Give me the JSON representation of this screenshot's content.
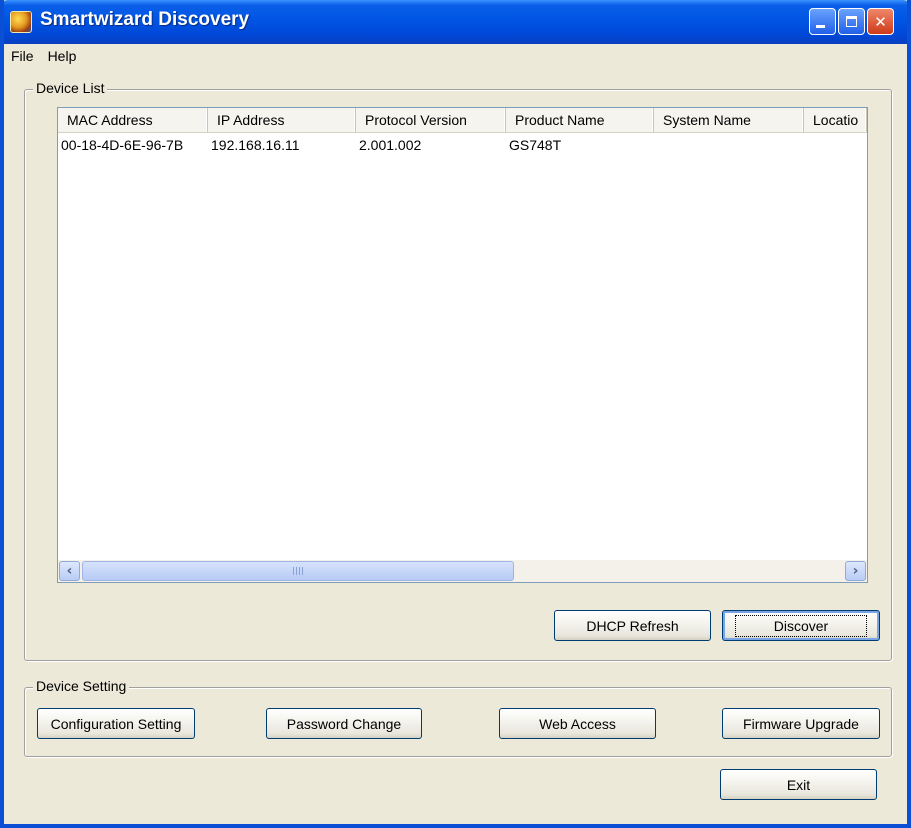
{
  "window": {
    "title": "Smartwizard Discovery"
  },
  "menu": {
    "file": "File",
    "help": "Help"
  },
  "device_list": {
    "group_label": "Device List",
    "columns": [
      "MAC Address",
      "IP Address",
      "Protocol Version",
      "Product Name",
      "System Name",
      "Locatio"
    ],
    "rows": [
      {
        "mac": "00-18-4D-6E-96-7B",
        "ip": "192.168.16.11",
        "protocol": "2.001.002",
        "product": "GS748T",
        "system_name": "",
        "location": ""
      }
    ],
    "buttons": {
      "dhcp_refresh": "DHCP Refresh",
      "discover": "Discover"
    }
  },
  "device_setting": {
    "group_label": "Device Setting",
    "buttons": {
      "configuration": "Configuration Setting",
      "password": "Password Change",
      "web_access": "Web Access",
      "firmware": "Firmware Upgrade"
    }
  },
  "exit_label": "Exit"
}
